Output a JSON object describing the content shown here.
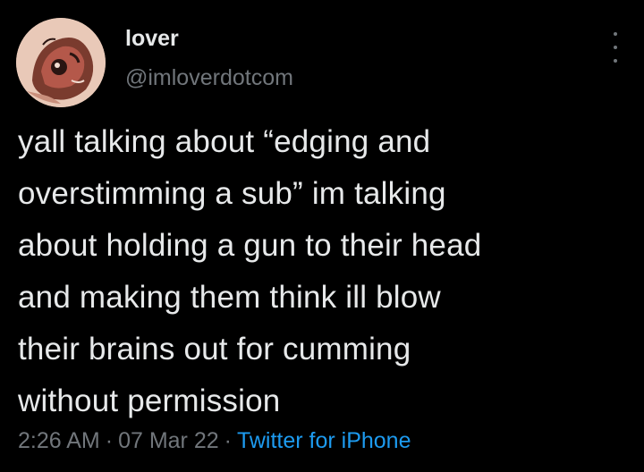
{
  "author": {
    "display_name": "lover",
    "handle": "@imloverdotcom",
    "avatar_icon": "avatar-illustration-icon"
  },
  "more_icon": "more-dots-vertical-icon",
  "tweet": {
    "text": "yall talking about “edging and\noverstimming a sub” im talking\nabout holding a gun to their head\nand making them think ill blow\ntheir brains out for cumming\nwithout permission"
  },
  "meta": {
    "time": "2:26 AM",
    "separator": "·",
    "date": "07 Mar 22",
    "source": "Twitter for iPhone"
  },
  "colors": {
    "background": "#000000",
    "text": "#e7e9ea",
    "secondary": "#71767b",
    "link": "#1d9bf0"
  }
}
